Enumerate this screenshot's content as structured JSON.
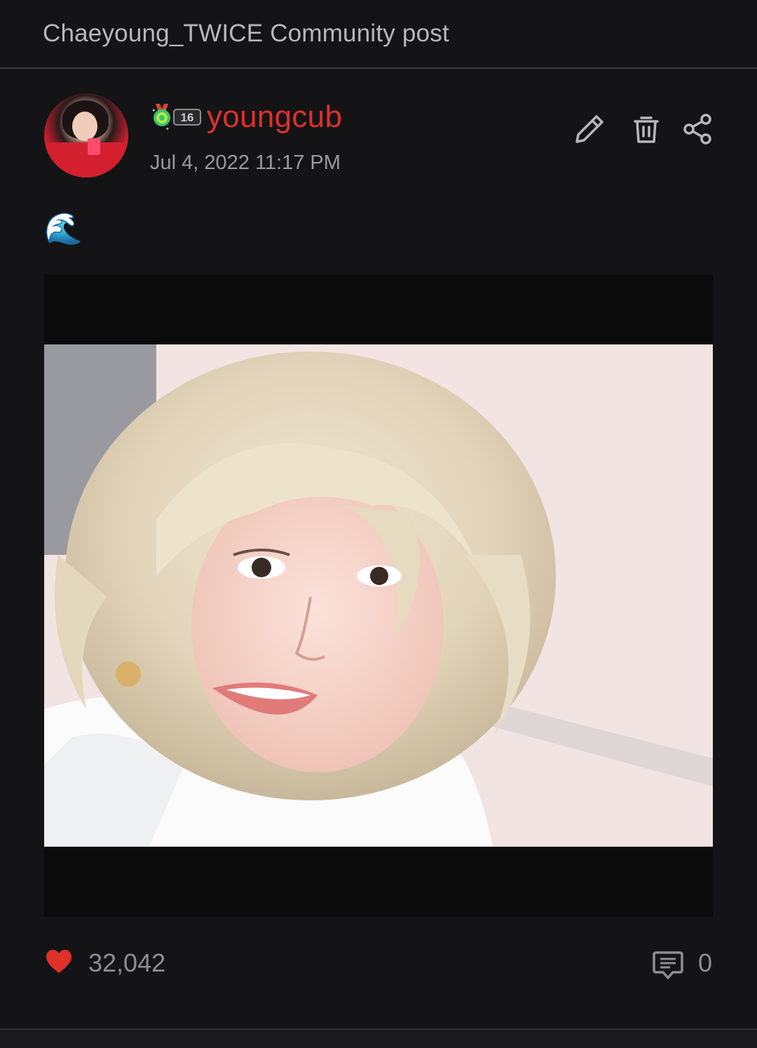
{
  "header": {
    "community": "Chaeyoung_TWICE",
    "subtitle": "Community post"
  },
  "post": {
    "author": {
      "username": "youngcub",
      "level": "16",
      "username_color": "#e0302a"
    },
    "timestamp": "Jul 4, 2022 11:17 PM",
    "text": "🌊",
    "actions": {
      "edit_icon": "pencil-icon",
      "delete_icon": "trash-icon",
      "share_icon": "share-icon"
    }
  },
  "footer": {
    "likes": "32,042",
    "comments": "0",
    "like_color": "#e0302a"
  }
}
